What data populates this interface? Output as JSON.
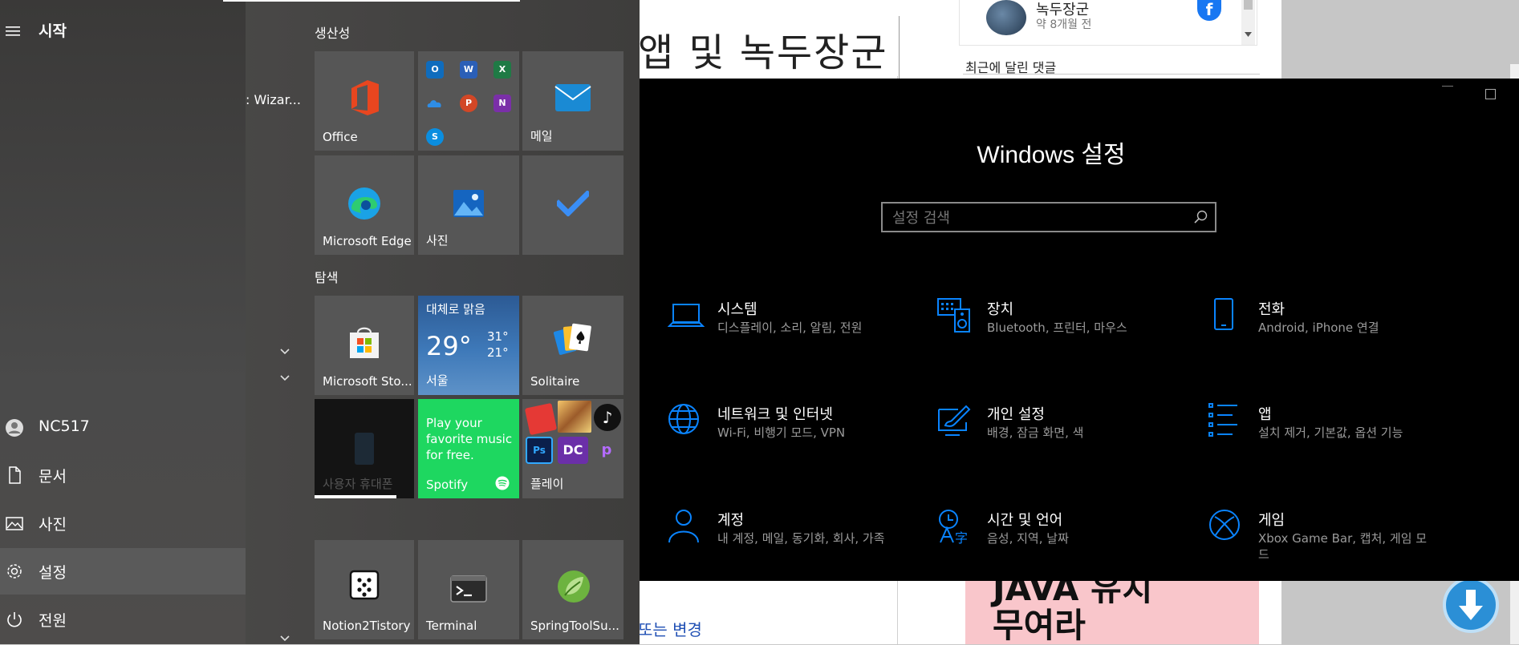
{
  "start_menu": {
    "title": "시작",
    "wizard_text": ": Wizar...",
    "rail": [
      {
        "name": "user",
        "label": "NC517"
      },
      {
        "name": "documents",
        "label": "문서"
      },
      {
        "name": "pictures",
        "label": "사진"
      },
      {
        "name": "settings",
        "label": "설정"
      },
      {
        "name": "power",
        "label": "전원"
      }
    ],
    "groups": {
      "productivity": "생산성",
      "explore": "탐색"
    },
    "tiles": {
      "office": "Office",
      "mail": "메일",
      "edge": "Microsoft Edge",
      "photos": "사진",
      "store": "Microsoft Sto...",
      "weather": {
        "condition": "대체로 맑음",
        "temp": "29°",
        "high": "31°",
        "low": "21°",
        "city": "서울"
      },
      "solitaire": "Solitaire",
      "phone": "사용자 휴대폰",
      "spotify": {
        "message": "Play your favorite music for free.",
        "name": "Spotify"
      },
      "play": "플레이",
      "notion": "Notion2Tistory",
      "terminal": "Terminal",
      "spring": "SpringToolSu..."
    },
    "office_mini_apps": [
      "outlook",
      "word",
      "excel",
      "onedrive",
      "powerpoint",
      "onenote",
      "skype"
    ]
  },
  "settings_window": {
    "title": "Windows 설정",
    "search_placeholder": "설정 검색",
    "categories": [
      {
        "title": "시스템",
        "desc": "디스플레이, 소리, 알림, 전원",
        "icon": "laptop-icon"
      },
      {
        "title": "장치",
        "desc": "Bluetooth, 프린터, 마우스",
        "icon": "devices-icon"
      },
      {
        "title": "전화",
        "desc": "Android, iPhone 연결",
        "icon": "phone-icon"
      },
      {
        "title": "네트워크 및 인터넷",
        "desc": "Wi-Fi, 비행기 모드, VPN",
        "icon": "globe-icon"
      },
      {
        "title": "개인 설정",
        "desc": "배경, 잠금 화면, 색",
        "icon": "personalization-icon"
      },
      {
        "title": "앱",
        "desc": "설치 제거, 기본값, 옵션 기능",
        "icon": "apps-icon"
      },
      {
        "title": "계정",
        "desc": "내 계정, 메일, 동기화, 회사, 가족",
        "icon": "person-icon"
      },
      {
        "title": "시간 및 언어",
        "desc": "음성, 지역, 날짜",
        "icon": "time-language-icon"
      },
      {
        "title": "게임",
        "desc": "Xbox Game Bar, 캡처, 게임 모드",
        "icon": "xbox-icon"
      }
    ],
    "accent": "#0a84ff"
  },
  "background_page": {
    "handwriting": "앱 및 녹두장군",
    "commenter_name": "녹두장군",
    "commenter_time": "약 8개월 전",
    "recent_comments": "최근에 달린 댓글",
    "bottom_link": "또는 변경",
    "banner_text": "JAVA 유치\n무여라"
  }
}
